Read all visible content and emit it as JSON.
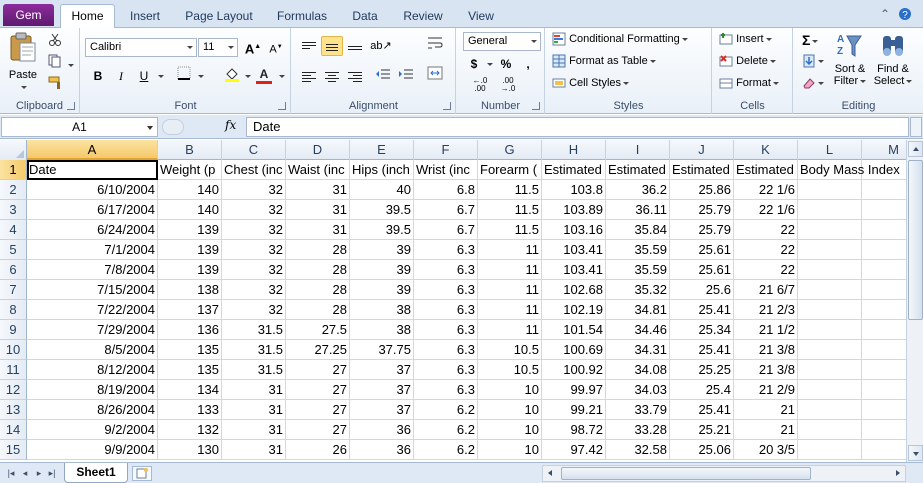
{
  "tabs": {
    "file": "Gem",
    "home": "Home",
    "insert": "Insert",
    "page_layout": "Page Layout",
    "formulas": "Formulas",
    "data": "Data",
    "review": "Review",
    "view": "View"
  },
  "ribbon": {
    "clipboard": {
      "label": "Clipboard",
      "paste": "Paste"
    },
    "font": {
      "label": "Font",
      "name": "Calibri",
      "size": "11",
      "bold": "B",
      "italic": "I",
      "underline": "U",
      "grow": "A",
      "shrink": "A",
      "font_color_letter": "A"
    },
    "alignment": {
      "label": "Alignment"
    },
    "number": {
      "label": "Number",
      "format": "General",
      "currency": "$",
      "percent": "%",
      "comma": ",",
      "inc_decimal": "←.0\n.00",
      "dec_decimal": ".00\n→.0"
    },
    "styles": {
      "label": "Styles",
      "conditional": "Conditional Formatting",
      "format_table": "Format as Table",
      "cell_styles": "Cell Styles"
    },
    "cells": {
      "label": "Cells",
      "insert": "Insert",
      "delete": "Delete",
      "format": "Format"
    },
    "editing": {
      "label": "Editing",
      "sum": "Σ",
      "sort_filter_1": "Sort &",
      "sort_filter_2": "Filter",
      "find_select_1": "Find &",
      "find_select_2": "Select"
    }
  },
  "formula_bar": {
    "name_box": "A1",
    "fx": "fx",
    "content": "Date"
  },
  "columns": [
    "A",
    "B",
    "C",
    "D",
    "E",
    "F",
    "G",
    "H",
    "I",
    "J",
    "K",
    "L",
    "M"
  ],
  "rows": [
    {
      "n": "1",
      "cells": [
        "Date",
        "Weight (p",
        "Chest (inc",
        "Waist (inc",
        "Hips (inch",
        "Wrist (inc",
        "Forearm (",
        "Estimated",
        "Estimated",
        "Estimated",
        "Estimated",
        "Body Mass Index",
        ""
      ]
    },
    {
      "n": "2",
      "cells": [
        "6/10/2004",
        "140",
        "32",
        "31",
        "40",
        "6.8",
        "11.5",
        "103.8",
        "36.2",
        "25.86",
        "22 1/6",
        "",
        ""
      ]
    },
    {
      "n": "3",
      "cells": [
        "6/17/2004",
        "140",
        "32",
        "31",
        "39.5",
        "6.7",
        "11.5",
        "103.89",
        "36.11",
        "25.79",
        "22 1/6",
        "",
        ""
      ]
    },
    {
      "n": "4",
      "cells": [
        "6/24/2004",
        "139",
        "32",
        "31",
        "39.5",
        "6.7",
        "11.5",
        "103.16",
        "35.84",
        "25.79",
        "22",
        "",
        ""
      ]
    },
    {
      "n": "5",
      "cells": [
        "7/1/2004",
        "139",
        "32",
        "28",
        "39",
        "6.3",
        "11",
        "103.41",
        "35.59",
        "25.61",
        "22",
        "",
        ""
      ]
    },
    {
      "n": "6",
      "cells": [
        "7/8/2004",
        "139",
        "32",
        "28",
        "39",
        "6.3",
        "11",
        "103.41",
        "35.59",
        "25.61",
        "22",
        "",
        ""
      ]
    },
    {
      "n": "7",
      "cells": [
        "7/15/2004",
        "138",
        "32",
        "28",
        "39",
        "6.3",
        "11",
        "102.68",
        "35.32",
        "25.6",
        "21 6/7",
        "",
        ""
      ]
    },
    {
      "n": "8",
      "cells": [
        "7/22/2004",
        "137",
        "32",
        "28",
        "38",
        "6.3",
        "11",
        "102.19",
        "34.81",
        "25.41",
        "21 2/3",
        "",
        ""
      ]
    },
    {
      "n": "9",
      "cells": [
        "7/29/2004",
        "136",
        "31.5",
        "27.5",
        "38",
        "6.3",
        "11",
        "101.54",
        "34.46",
        "25.34",
        "21 1/2",
        "",
        ""
      ]
    },
    {
      "n": "10",
      "cells": [
        "8/5/2004",
        "135",
        "31.5",
        "27.25",
        "37.75",
        "6.3",
        "10.5",
        "100.69",
        "34.31",
        "25.41",
        "21 3/8",
        "",
        ""
      ]
    },
    {
      "n": "11",
      "cells": [
        "8/12/2004",
        "135",
        "31.5",
        "27",
        "37",
        "6.3",
        "10.5",
        "100.92",
        "34.08",
        "25.25",
        "21 3/8",
        "",
        ""
      ]
    },
    {
      "n": "12",
      "cells": [
        "8/19/2004",
        "134",
        "31",
        "27",
        "37",
        "6.3",
        "10",
        "99.97",
        "34.03",
        "25.4",
        "21 2/9",
        "",
        ""
      ]
    },
    {
      "n": "13",
      "cells": [
        "8/26/2004",
        "133",
        "31",
        "27",
        "37",
        "6.2",
        "10",
        "99.21",
        "33.79",
        "25.41",
        "21",
        "",
        ""
      ]
    },
    {
      "n": "14",
      "cells": [
        "9/2/2004",
        "132",
        "31",
        "27",
        "36",
        "6.2",
        "10",
        "98.72",
        "33.28",
        "25.21",
        "21",
        "",
        ""
      ]
    },
    {
      "n": "15",
      "cells": [
        "9/9/2004",
        "130",
        "31",
        "26",
        "36",
        "6.2",
        "10",
        "97.42",
        "32.58",
        "25.06",
        "20 3/5",
        "",
        ""
      ]
    }
  ],
  "sheet": {
    "name": "Sheet1"
  }
}
